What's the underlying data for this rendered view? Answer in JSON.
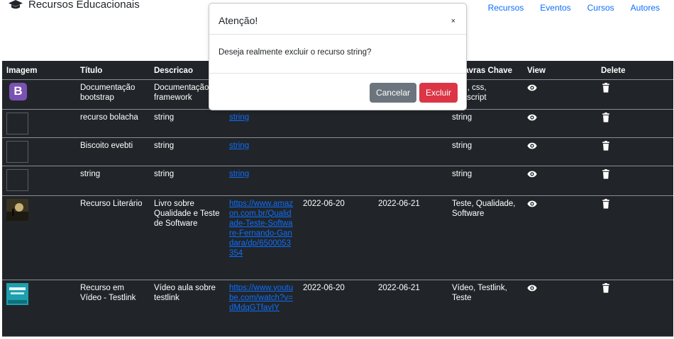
{
  "brand": {
    "title": "Recursos Educacionais"
  },
  "nav": {
    "links": [
      "Recursos",
      "Eventos",
      "Cursos",
      "Autores"
    ]
  },
  "table": {
    "headers": [
      "Imagem",
      "Título",
      "Descricao",
      "",
      "",
      "",
      "Palavras Chave",
      "View",
      "Delete"
    ],
    "rows": [
      {
        "thumb": "bootstrap",
        "titulo": "Documentação bootstrap",
        "descricao": "Documentação do framework",
        "link": "",
        "data1": "",
        "data2": "",
        "palavras": "html, css, javascript"
      },
      {
        "thumb": "empty",
        "titulo": "recurso bolacha",
        "descricao": "string",
        "link": "string",
        "data1": "",
        "data2": "",
        "palavras": "string"
      },
      {
        "thumb": "empty",
        "titulo": "Biscoito evebti",
        "descricao": "string",
        "link": "string",
        "data1": "",
        "data2": "",
        "palavras": "string"
      },
      {
        "thumb": "empty",
        "titulo": "string",
        "descricao": "string",
        "link": "string",
        "data1": "",
        "data2": "",
        "palavras": "string"
      },
      {
        "thumb": "book",
        "titulo": "Recurso Literário",
        "descricao": "Livro sobre Qualidade e Teste de Software",
        "link": "https://www.amazon.com.br/Qualidade-Teste-Software-Fernando-Gandara/dp/6500053354",
        "data1": "2022-06-20",
        "data2": "2022-06-21",
        "palavras": "Teste, Qualidade, Software"
      },
      {
        "thumb": "video",
        "titulo": "Recurso em Vídeo - Testlink",
        "descricao": "Vídeo aula sobre testlink",
        "link": "https://www.youtube.com/watch?v=dMdqGTfavIY",
        "data1": "2022-06-20",
        "data2": "2022-06-21",
        "palavras": "Vídeo, Testlink, Teste"
      }
    ]
  },
  "modal": {
    "title": "Atenção!",
    "close": "×",
    "message": "Deseja realmente excluir o recurso string?",
    "cancel": "Cancelar",
    "confirm": "Excluir"
  },
  "colors": {
    "primary": "#0d6efd",
    "danger": "#dc3545",
    "secondary": "#6c757d",
    "table_bg": "#212529"
  }
}
